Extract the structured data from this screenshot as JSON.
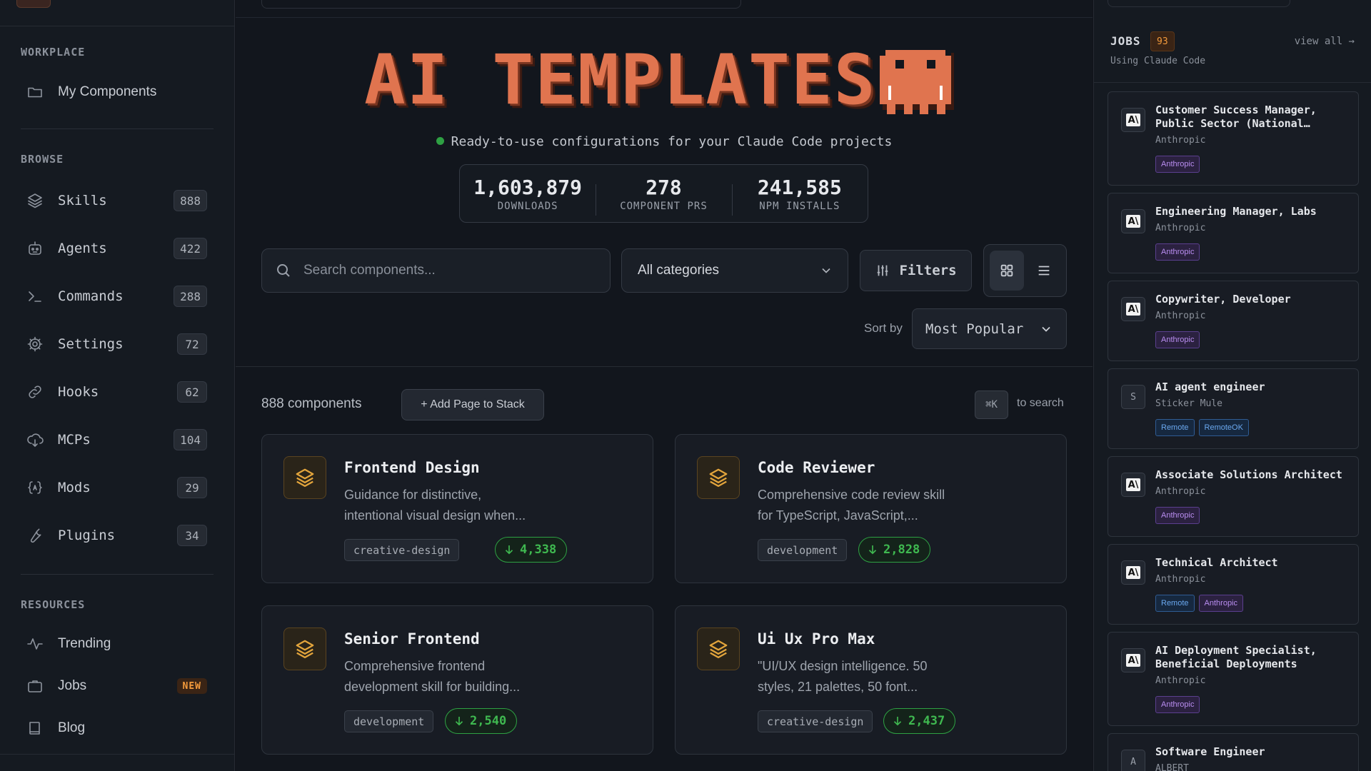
{
  "sidebar": {
    "workplace_title": "WORKPLACE",
    "my_components": "My Components",
    "browse_title": "BROWSE",
    "browse_items": [
      {
        "label": "Skills",
        "count": "888",
        "icon": "layers-icon"
      },
      {
        "label": "Agents",
        "count": "422",
        "icon": "robot-icon"
      },
      {
        "label": "Commands",
        "count": "288",
        "icon": "terminal-icon"
      },
      {
        "label": "Settings",
        "count": "72",
        "icon": "gear-icon"
      },
      {
        "label": "Hooks",
        "count": "62",
        "icon": "link-icon"
      },
      {
        "label": "MCPs",
        "count": "104",
        "icon": "cloud-download-icon"
      },
      {
        "label": "Mods",
        "count": "29",
        "icon": "braces-icon"
      },
      {
        "label": "Plugins",
        "count": "34",
        "icon": "wrench-icon"
      }
    ],
    "resources_title": "RESOURCES",
    "resources": [
      {
        "label": "Trending",
        "icon": "activity-icon"
      },
      {
        "label": "Jobs",
        "icon": "briefcase-icon",
        "badge": "NEW"
      },
      {
        "label": "Blog",
        "icon": "book-icon"
      }
    ]
  },
  "hero": {
    "title": "AI TEMPLATES",
    "tagline": "Ready-to-use configurations for your Claude Code projects",
    "status_color": "#2ea043",
    "accent_color": "#e0744f"
  },
  "stats": [
    {
      "value": "1,603,879",
      "label": "DOWNLOADS"
    },
    {
      "value": "278",
      "label": "COMPONENT PRS"
    },
    {
      "value": "241,585",
      "label": "NPM INSTALLS"
    }
  ],
  "toolbar": {
    "search_placeholder": "Search components...",
    "category": "All categories",
    "filters_label": "Filters",
    "sort_label": "Sort by",
    "sort_value": "Most Popular"
  },
  "listing": {
    "count_label": "888 components",
    "add_stack_label": "+ Add Page to Stack",
    "kbd": "⌘K",
    "kbd_hint": "to search"
  },
  "cards": [
    {
      "title": "Frontend Design",
      "desc1": "Guidance for distinctive,",
      "desc2": "intentional visual design when...",
      "tag": "creative-design",
      "downloads": "4,338"
    },
    {
      "title": "Code Reviewer",
      "desc1": "Comprehensive code review skill",
      "desc2": "for TypeScript, JavaScript,...",
      "tag": "development",
      "downloads": "2,828"
    },
    {
      "title": "Senior Frontend",
      "desc1": "Comprehensive frontend",
      "desc2": "development skill for building...",
      "tag": "development",
      "downloads": "2,540"
    },
    {
      "title": "Ui Ux Pro Max",
      "desc1": "\"UI/UX design intelligence. 50",
      "desc2": "styles, 21 palettes, 50 font...",
      "tag": "creative-design",
      "downloads": "2,437"
    }
  ],
  "jobs": {
    "title": "JOBS",
    "count": "93",
    "subtitle": "Using Claude Code",
    "view_all": "view all →",
    "items": [
      {
        "title": "Customer Success Manager, Public Sector (National…",
        "company": "Anthropic",
        "logo": "A\\",
        "tags": [
          "Anthropic"
        ]
      },
      {
        "title": "Engineering Manager, Labs",
        "company": "Anthropic",
        "logo": "A\\",
        "tags": [
          "Anthropic"
        ]
      },
      {
        "title": "Copywriter, Developer",
        "company": "Anthropic",
        "logo": "A\\",
        "tags": [
          "Anthropic"
        ]
      },
      {
        "title": "AI agent engineer",
        "company": "Sticker Mule",
        "logo": "S",
        "tags": [
          "Remote",
          "RemoteOK"
        ]
      },
      {
        "title": "Associate Solutions Architect",
        "company": "Anthropic",
        "logo": "A\\",
        "tags": [
          "Anthropic"
        ]
      },
      {
        "title": "Technical Architect",
        "company": "Anthropic",
        "logo": "A\\",
        "tags": [
          "Remote",
          "Anthropic"
        ]
      },
      {
        "title": "AI Deployment Specialist, Beneficial Deployments",
        "company": "Anthropic",
        "logo": "A\\",
        "tags": [
          "Anthropic"
        ]
      },
      {
        "title": "Software Engineer",
        "company": "ALBERT",
        "logo": "A",
        "tags": []
      }
    ]
  }
}
